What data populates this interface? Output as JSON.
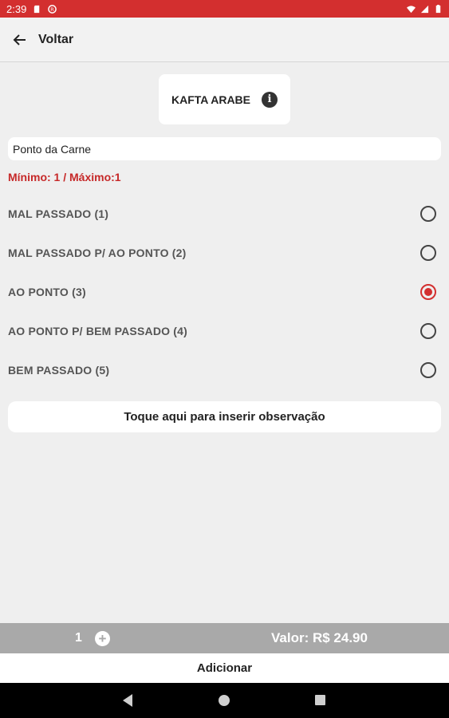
{
  "status_bar": {
    "time": "2:39",
    "icons": [
      "sd-card-icon",
      "sync-icon",
      "wifi-icon",
      "signal-icon",
      "battery-icon"
    ]
  },
  "app_bar": {
    "back_label": "Voltar",
    "back_icon": "arrow-left-icon"
  },
  "product": {
    "name": "KAFTA ARABE",
    "info_icon": "i"
  },
  "group": {
    "title": "Ponto da Carne",
    "min_max": "Mínimo: 1 / Máximo:1",
    "options": [
      {
        "label": "MAL PASSADO (1)",
        "selected": false
      },
      {
        "label": "MAL PASSADO P/ AO PONTO (2)",
        "selected": false
      },
      {
        "label": "AO PONTO (3)",
        "selected": true
      },
      {
        "label": "AO PONTO P/ BEM PASSADO (4)",
        "selected": false
      },
      {
        "label": "BEM PASSADO (5)",
        "selected": false
      }
    ]
  },
  "observation_button": "Toque aqui para inserir observação",
  "footer": {
    "quantity": "1",
    "plus_symbol": "+",
    "value_text": "Valor: R$ 24.90",
    "add_label": "Adicionar"
  },
  "colors": {
    "accent": "#d32f2f",
    "bottom_bar": "#a9a9a9",
    "background": "#efefef"
  }
}
